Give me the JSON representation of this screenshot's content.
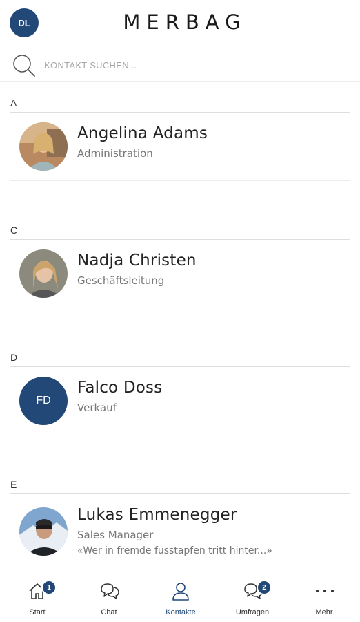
{
  "header": {
    "user_initials": "DL",
    "logo_text": "MERBAG"
  },
  "search": {
    "placeholder": "KONTAKT SUCHEN..."
  },
  "sections": [
    {
      "letter": "A",
      "contacts": [
        {
          "name": "Angelina Adams",
          "role": "Administration",
          "avatar": "photo",
          "status": ""
        }
      ]
    },
    {
      "letter": "C",
      "contacts": [
        {
          "name": "Nadja Christen",
          "role": "Geschäftsleitung",
          "avatar": "photo",
          "status": ""
        }
      ]
    },
    {
      "letter": "D",
      "contacts": [
        {
          "name": "Falco Doss",
          "role": "Verkauf",
          "avatar": "initials",
          "initials": "FD",
          "status": ""
        }
      ]
    },
    {
      "letter": "E",
      "contacts": [
        {
          "name": "Lukas Emmenegger",
          "role": "Sales Manager",
          "avatar": "photo",
          "status": "«Wer in fremde fusstapfen tritt hinter...»"
        }
      ]
    }
  ],
  "tabbar": {
    "tabs": [
      {
        "label": "Start",
        "icon": "home-icon",
        "badge": "1"
      },
      {
        "label": "Chat",
        "icon": "chat-icon",
        "badge": ""
      },
      {
        "label": "Kontakte",
        "icon": "person-icon",
        "badge": "",
        "active": true
      },
      {
        "label": "Umfragen",
        "icon": "survey-chat-icon",
        "badge": "2"
      },
      {
        "label": "Mehr",
        "icon": "more-dots-icon",
        "badge": ""
      }
    ]
  },
  "colors": {
    "accent": "#214877",
    "text": "#222222",
    "secondary_text": "#777777",
    "divider": "#dedede"
  }
}
